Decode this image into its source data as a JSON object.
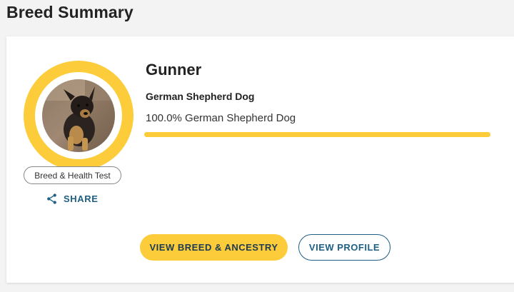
{
  "page": {
    "section_title": "Breed Summary"
  },
  "dog": {
    "name": "Gunner",
    "primary_breed": "German Shepherd Dog",
    "breed_percentage_text": "100.0% German Shepherd Dog",
    "breed_percentage": 100.0,
    "test_type": "Breed & Health Test",
    "photo": "dog-photo"
  },
  "actions": {
    "share_label": "SHARE",
    "share_icon": "share-icon",
    "view_breed_label": "VIEW BREED & ANCESTRY",
    "view_profile_label": "VIEW PROFILE"
  },
  "colors": {
    "accent_yellow": "#fccc3a",
    "link_blue": "#1d5f85",
    "button_text": "#1d3b52"
  }
}
